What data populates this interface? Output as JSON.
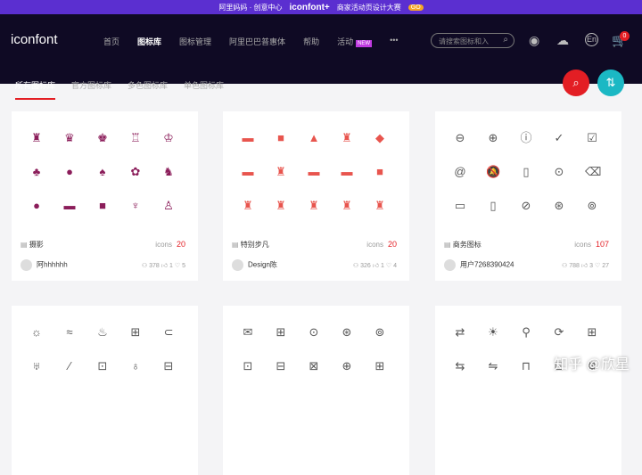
{
  "banner": {
    "text": "阿里妈妈 · 创意中心",
    "brand": "iconfont+",
    "campaign": "商家活动页设计大赛",
    "badge": "GO"
  },
  "nav": {
    "logo": "iconfont",
    "items": [
      "首页",
      "图标库",
      "图标管理",
      "阿里巴巴普惠体",
      "帮助",
      "活动"
    ],
    "new_badge": "NEW",
    "more": "•••",
    "search_placeholder": "请搜索图标和入",
    "cart_count": "0",
    "lang": "En"
  },
  "tabs": [
    "所有图标库",
    "官方图标库",
    "多色图标库",
    "单色图标库"
  ],
  "colors": {
    "nav": "#0f0a24",
    "accent": "#e31e24",
    "teal": "#1bb8c4",
    "purple": "#8b1d5a",
    "salmon": "#e8554e"
  },
  "cards": [
    {
      "name": "摄影",
      "icons_label": "icons",
      "count": "20",
      "user": "阿hhhhhh",
      "views": "378",
      "likes": "1",
      "favs": "5",
      "color": "#8b1d5a",
      "glyphs": [
        "♜",
        "♛",
        "♚",
        "♖",
        "♔",
        "♣",
        "●",
        "♠",
        "✿",
        "♞",
        "●",
        "▬",
        "■",
        "♆",
        "♙"
      ]
    },
    {
      "name": "特别步凡",
      "icons_label": "icons",
      "count": "20",
      "user": "Design陈",
      "views": "326",
      "likes": "1",
      "favs": "4",
      "color": "#e8554e",
      "glyphs": [
        "▬",
        "■",
        "▲",
        "♜",
        "◆",
        "▬",
        "♜",
        "▬",
        "▬",
        "■",
        "♜",
        "♜",
        "♜",
        "♜",
        "♜"
      ]
    },
    {
      "name": "商务图标",
      "icons_label": "icons",
      "count": "107",
      "user": "用户7268390424",
      "views": "788",
      "likes": "3",
      "favs": "27",
      "color": "#555",
      "glyphs": [
        "⊖",
        "⊕",
        "ⓘ",
        "✓",
        "☑",
        "@",
        "🔕",
        "▯",
        "⊙",
        "⌫",
        "▭",
        "▯",
        "⊘",
        "⊛",
        "⊚"
      ]
    },
    {
      "glyphs": [
        "☼",
        "≈",
        "♨",
        "⊞",
        "⊂",
        "♅",
        "⁄",
        "⊡",
        "♁",
        "⊟"
      ],
      "color": "#555"
    },
    {
      "glyphs": [
        "✉",
        "⊞",
        "⊙",
        "⊛",
        "⊚",
        "⊡",
        "⊟",
        "⊠",
        "⊕",
        "⊞"
      ],
      "color": "#555"
    },
    {
      "glyphs": [
        "⇄",
        "☀",
        "⚲",
        "⟳",
        "⊞",
        "⇆",
        "⇋",
        "⊓",
        "⊟",
        "⚙"
      ],
      "color": "#555"
    }
  ],
  "watermark": "知乎 @欣星"
}
